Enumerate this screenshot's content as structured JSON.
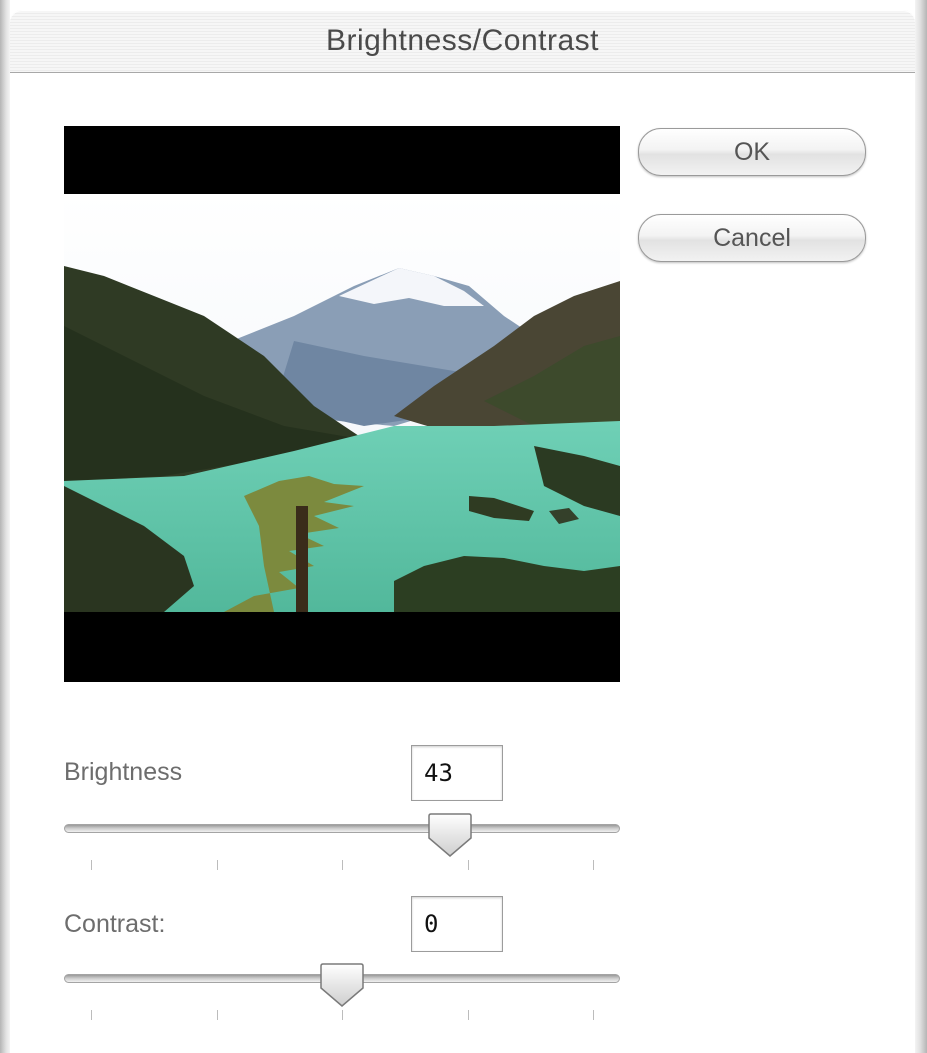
{
  "window": {
    "title": "Brightness/Contrast"
  },
  "buttons": {
    "ok_label": "OK",
    "cancel_label": "Cancel"
  },
  "controls": {
    "brightness": {
      "label": "Brightness",
      "value": "43",
      "min": -100,
      "max": 100,
      "ticks": 5
    },
    "contrast": {
      "label": "Contrast:",
      "value": "0",
      "min": -100,
      "max": 100,
      "ticks": 5
    }
  },
  "colors": {
    "preview_background": "#000000",
    "lake": "#5fc4a6",
    "sky": "#ffffff",
    "label_text": "#6d6d6d",
    "button_text": "#555555"
  }
}
